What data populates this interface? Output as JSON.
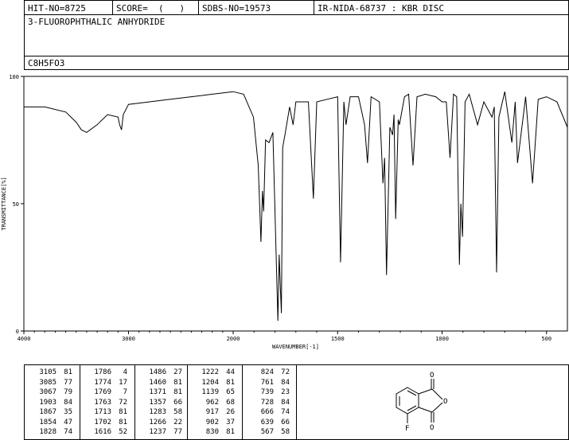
{
  "header": {
    "hit_no": "HIT-NO=8725",
    "score": "SCORE=  (   )",
    "sdbs_no": "SDBS-NO=19573",
    "ir_info": "IR-NIDA-68737 : KBR DISC",
    "compound_name": "3-FLUOROPHTHALIC ANHYDRIDE",
    "formula": "C8H5FO3"
  },
  "chart_data": {
    "type": "line",
    "xlabel": "WAVENUMBER[-1]",
    "ylabel": "TRANSMITTANCE[%]",
    "xlim": [
      4000,
      400
    ],
    "ylim": [
      0,
      100
    ],
    "x_ticks": [
      4000,
      3000,
      2000,
      1500,
      1000,
      500
    ],
    "y_ticks": [
      0,
      50,
      100
    ],
    "grid": false,
    "series": [
      {
        "x": [
          4000,
          3800,
          3600,
          3500,
          3450,
          3400,
          3300,
          3200,
          3100,
          3085,
          3067,
          3050,
          3000,
          2800,
          2600,
          2400,
          2200,
          2000,
          1950,
          1903,
          1880,
          1867,
          1860,
          1854,
          1845,
          1828,
          1810,
          1786,
          1780,
          1774,
          1769,
          1763,
          1750,
          1730,
          1713,
          1700,
          1640,
          1616,
          1600,
          1550,
          1500,
          1486,
          1470,
          1460,
          1440,
          1400,
          1371,
          1357,
          1340,
          1300,
          1283,
          1275,
          1266,
          1250,
          1237,
          1230,
          1222,
          1210,
          1204,
          1180,
          1160,
          1139,
          1120,
          1080,
          1030,
          1000,
          980,
          962,
          945,
          930,
          917,
          910,
          902,
          890,
          870,
          830,
          800,
          761,
          750,
          739,
          728,
          700,
          666,
          650,
          639,
          600,
          567,
          540,
          500,
          450,
          400
        ],
        "y": [
          88,
          88,
          86,
          82,
          79,
          78,
          81,
          85,
          84,
          81,
          79,
          85,
          89,
          90,
          91,
          92,
          93,
          94,
          93,
          84,
          65,
          35,
          55,
          47,
          75,
          74,
          78,
          4,
          30,
          17,
          7,
          72,
          78,
          88,
          81,
          90,
          90,
          52,
          90,
          91,
          92,
          27,
          90,
          81,
          92,
          92,
          81,
          66,
          92,
          90,
          58,
          68,
          22,
          80,
          77,
          85,
          44,
          83,
          81,
          92,
          93,
          65,
          92,
          93,
          92,
          90,
          90,
          68,
          93,
          92,
          26,
          50,
          37,
          90,
          93,
          81,
          90,
          84,
          88,
          23,
          84,
          94,
          74,
          90,
          66,
          92,
          58,
          91,
          92,
          90,
          80
        ]
      }
    ]
  },
  "peak_table": [
    [
      [
        "3105",
        "81"
      ],
      [
        "3085",
        "77"
      ],
      [
        "3067",
        "79"
      ],
      [
        "1903",
        "84"
      ],
      [
        "1867",
        "35"
      ],
      [
        "1854",
        "47"
      ],
      [
        "1828",
        "74"
      ]
    ],
    [
      [
        "1786",
        "4"
      ],
      [
        "1774",
        "17"
      ],
      [
        "1769",
        "7"
      ],
      [
        "1763",
        "72"
      ],
      [
        "1713",
        "81"
      ],
      [
        "1702",
        "81"
      ],
      [
        "1616",
        "52"
      ]
    ],
    [
      [
        "1486",
        "27"
      ],
      [
        "1460",
        "81"
      ],
      [
        "1371",
        "81"
      ],
      [
        "1357",
        "66"
      ],
      [
        "1283",
        "58"
      ],
      [
        "1266",
        "22"
      ],
      [
        "1237",
        "77"
      ]
    ],
    [
      [
        "1222",
        "44"
      ],
      [
        "1204",
        "81"
      ],
      [
        "1139",
        "65"
      ],
      [
        "962",
        "68"
      ],
      [
        "917",
        "26"
      ],
      [
        "902",
        "37"
      ],
      [
        "830",
        "81"
      ]
    ],
    [
      [
        "824",
        "72"
      ],
      [
        "761",
        "84"
      ],
      [
        "739",
        "23"
      ],
      [
        "728",
        "84"
      ],
      [
        "666",
        "74"
      ],
      [
        "639",
        "66"
      ],
      [
        "567",
        "58"
      ]
    ]
  ],
  "structure_labels": {
    "top_o": "O",
    "ring_o": "O",
    "bottom_o": "O",
    "fluorine": "F"
  }
}
